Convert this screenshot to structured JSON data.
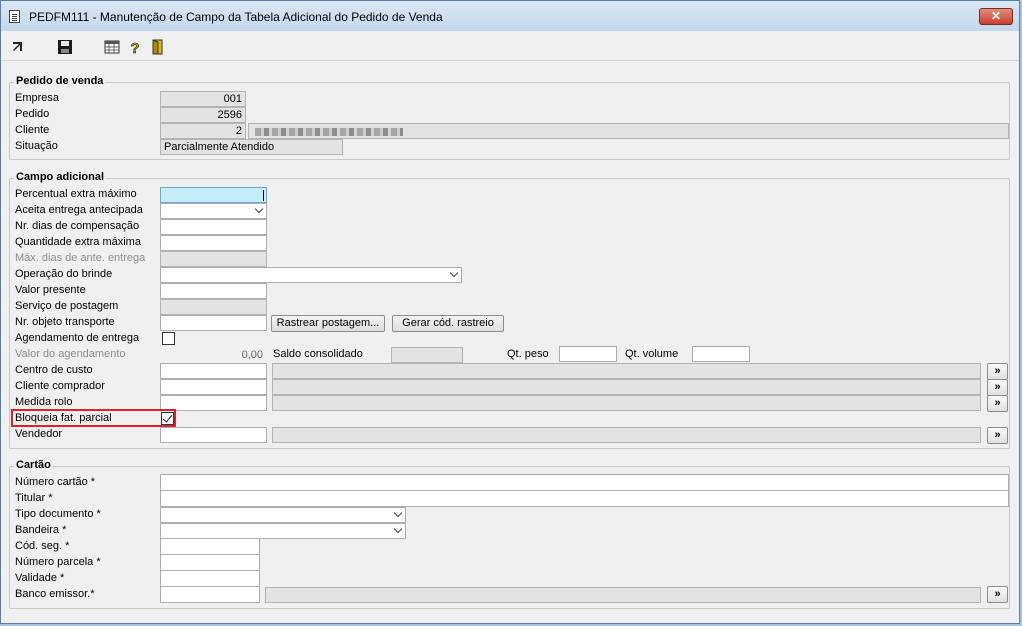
{
  "window": {
    "title": "PEDFM111 - Manutenção de Campo da Tabela Adicional do Pedido de Venda",
    "close": "✕"
  },
  "toolbar": {
    "icons": [
      "exit-icon",
      "save-icon",
      "grid-icon",
      "help-icon",
      "door-icon"
    ]
  },
  "pedido": {
    "title": "Pedido de venda",
    "empresa_label": "Empresa",
    "empresa_value": "001",
    "pedido_label": "Pedido",
    "pedido_value": "2596",
    "cliente_label": "Cliente",
    "cliente_value": "2",
    "situacao_label": "Situação",
    "situacao_value": "Parcialmente Atendido"
  },
  "campo": {
    "title": "Campo adicional",
    "percentual_label": "Percentual extra máximo",
    "percentual_value": "",
    "aceita_label": "Aceita entrega antecipada",
    "aceita_value": "",
    "nr_dias_label": "Nr. dias de compensação",
    "nr_dias_value": "",
    "qtd_extra_label": "Quantidade extra máxima",
    "qtd_extra_value": "",
    "max_dias_label": "Máx. dias de ante. entrega",
    "operacao_label": "Operação do brinde",
    "operacao_value": "",
    "valor_presente_label": "Valor presente",
    "valor_presente_value": "",
    "servico_label": "Serviço de postagem",
    "nr_objeto_label": "Nr. objeto transporte",
    "nr_objeto_value": "",
    "rastrear_button": "Rastrear postagem...",
    "gerar_button": "Gerar cód. rastreio",
    "agendamento_label": "Agendamento de entrega",
    "agendamento_checked": false,
    "valor_agendamento_label": "Valor do agendamento",
    "valor_agendamento_value": "0,00",
    "saldo_label": "Saldo consolidado",
    "qt_peso_label": "Qt. peso",
    "qt_peso_value": "",
    "qt_volume_label": "Qt. volume",
    "qt_volume_value": "",
    "centro_label": "Centro de custo",
    "centro_value": "",
    "cliente_comprador_label": "Cliente comprador",
    "cliente_comprador_value": "",
    "medida_label": "Medida rolo",
    "medida_value": "",
    "bloqueia_label": "Bloqueia fat. parcial",
    "bloqueia_checked": true,
    "vendedor_label": "Vendedor",
    "vendedor_value": "",
    "lookup_symbol": "»"
  },
  "cartao": {
    "title": "Cartão",
    "numero_label": "Número cartão *",
    "numero_value": "",
    "titular_label": "Titular *",
    "titular_value": "",
    "tipo_label": "Tipo documento *",
    "tipo_value": "",
    "bandeira_label": "Bandeira *",
    "bandeira_value": "",
    "cod_label": "Cód. seg. *",
    "cod_value": "",
    "parcela_label": "Número parcela *",
    "parcela_value": "",
    "validade_label": "Validade *",
    "validade_value": "",
    "banco_label": "Banco emissor.*",
    "banco_value": "",
    "lookup_symbol": "»"
  },
  "colors": {
    "title_bar": "#c3d7ec",
    "close": "#c7402c",
    "highlight": "#e0202a",
    "focus": "#c6eef9"
  }
}
